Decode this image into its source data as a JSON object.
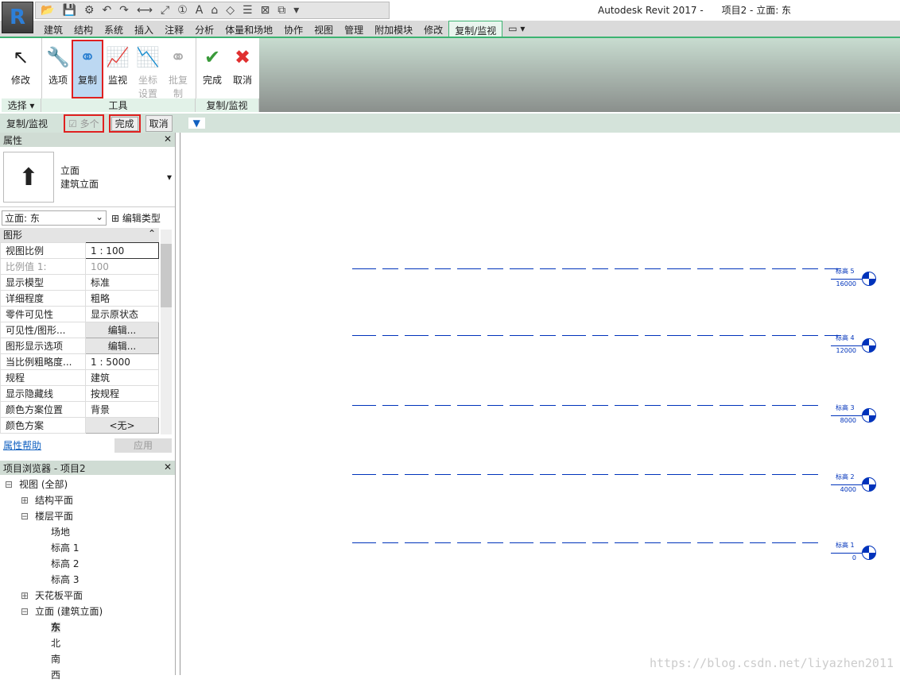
{
  "app": {
    "logo": "R",
    "title": "Autodesk Revit 2017 -",
    "doc": "项目2 - 立面: 东"
  },
  "tabs": [
    "建筑",
    "结构",
    "系统",
    "插入",
    "注释",
    "分析",
    "体量和场地",
    "协作",
    "视图",
    "管理",
    "附加模块",
    "修改",
    "复制/监视"
  ],
  "active_tab": "复制/监视",
  "ribbon": {
    "buttons": [
      {
        "label": "修改",
        "icon": "cursor-icon"
      },
      {
        "label": "选项",
        "icon": "wrench-icon"
      },
      {
        "label": "复制",
        "icon": "copy-icon"
      },
      {
        "label": "监视",
        "icon": "monitor-icon"
      },
      {
        "label": "坐标设置",
        "icon": "coordinate-icon"
      },
      {
        "label": "批复制",
        "icon": "batch-copy-icon"
      },
      {
        "label": "完成",
        "icon": "check-icon"
      },
      {
        "label": "取消",
        "icon": "x-icon"
      }
    ],
    "panels": [
      "选择 ▾",
      "工具",
      "复制/监视"
    ]
  },
  "optbar": {
    "label": "复制/监视",
    "multiple": "多个",
    "finish": "完成",
    "cancel": "取消"
  },
  "properties": {
    "title": "属性",
    "type_name": "立面",
    "type_sub": "建筑立面",
    "selector": "立面: 东",
    "edit_type": "编辑类型",
    "group": "图形",
    "rows": [
      [
        "视图比例",
        "1 : 100"
      ],
      [
        "比例值 1:",
        "100"
      ],
      [
        "显示模型",
        "标准"
      ],
      [
        "详细程度",
        "粗略"
      ],
      [
        "零件可见性",
        "显示原状态"
      ],
      [
        "可见性/图形...",
        "编辑..."
      ],
      [
        "图形显示选项",
        "编辑..."
      ],
      [
        "当比例粗略度...",
        "1 : 5000"
      ],
      [
        "规程",
        "建筑"
      ],
      [
        "显示隐藏线",
        "按规程"
      ],
      [
        "颜色方案位置",
        "背景"
      ],
      [
        "颜色方案",
        "<无>"
      ]
    ],
    "help": "属性帮助",
    "apply": "应用"
  },
  "browser": {
    "title": "项目浏览器 - 项目2",
    "items": [
      [
        "0",
        "⊟",
        "视图 (全部)"
      ],
      [
        "1",
        "⊞",
        "结构平面"
      ],
      [
        "1",
        "⊟",
        "楼层平面"
      ],
      [
        "2",
        "",
        "场地"
      ],
      [
        "2",
        "",
        "标高 1"
      ],
      [
        "2",
        "",
        "标高 2"
      ],
      [
        "2",
        "",
        "标高 3"
      ],
      [
        "1",
        "⊞",
        "天花板平面"
      ],
      [
        "1",
        "⊟",
        "立面 (建筑立面)"
      ],
      [
        "2",
        "",
        "东"
      ],
      [
        "2",
        "",
        "北"
      ],
      [
        "2",
        "",
        "南"
      ],
      [
        "2",
        "",
        "西"
      ]
    ]
  },
  "levels": [
    {
      "name": "标高 5",
      "elev": "16000"
    },
    {
      "name": "标高 4",
      "elev": "12000"
    },
    {
      "name": "标高 3",
      "elev": "8000"
    },
    {
      "name": "标高 2",
      "elev": "4000"
    },
    {
      "name": "标高 1",
      "elev": "0"
    }
  ],
  "watermark": "https://blog.csdn.net/liyazhen2011"
}
